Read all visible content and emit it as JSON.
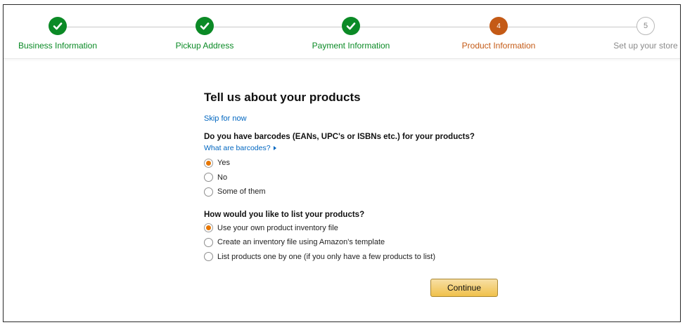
{
  "steps": [
    {
      "number": "",
      "label": "Business Information",
      "status": "done"
    },
    {
      "number": "",
      "label": "Pickup Address",
      "status": "done"
    },
    {
      "number": "",
      "label": "Payment Information",
      "status": "done"
    },
    {
      "number": "4",
      "label": "Product Information",
      "status": "current"
    },
    {
      "number": "5",
      "label": "Set up your store",
      "status": "todo"
    }
  ],
  "colors": {
    "done": "#0b8a26",
    "current": "#c45a16",
    "link": "#0066c0",
    "radio_selected": "#e77600",
    "button_top": "#f7dfa5",
    "button_bottom": "#f0c14b"
  },
  "main": {
    "title": "Tell us about your products",
    "skip_link": "Skip for now",
    "barcodes": {
      "question": "Do you have barcodes (EANs, UPC's or ISBNs etc.) for your products?",
      "help_link": "What are barcodes?",
      "options": [
        {
          "label": "Yes",
          "selected": true
        },
        {
          "label": "No",
          "selected": false
        },
        {
          "label": "Some of them",
          "selected": false
        }
      ]
    },
    "listing": {
      "question": "How would you like to list your products?",
      "options": [
        {
          "label": "Use your own product inventory file",
          "selected": true
        },
        {
          "label": "Create an inventory file using Amazon's template",
          "selected": false
        },
        {
          "label": "List products one by one (if you only have a few products to list)",
          "selected": false
        }
      ]
    },
    "continue_label": "Continue"
  }
}
